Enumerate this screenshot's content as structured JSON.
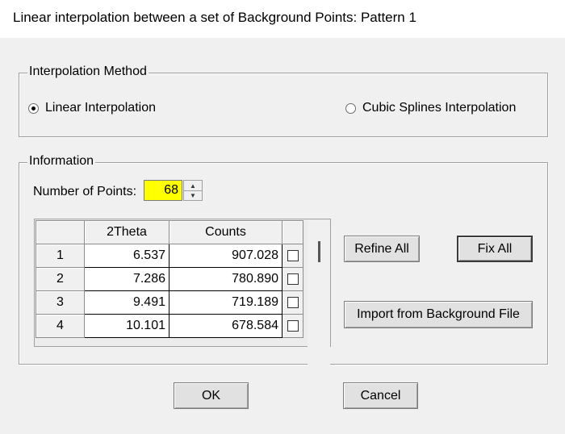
{
  "window": {
    "title": "Linear interpolation between a set of Background Points: Pattern 1"
  },
  "interpolation": {
    "group_label": "Interpolation Method",
    "linear_label": "Linear Interpolation",
    "cubic_label": "Cubic Splines Interpolation",
    "selected": "linear"
  },
  "information": {
    "group_label": "Information",
    "num_points_label": "Number of Points:",
    "num_points_value": "68",
    "num_points_bg": "#ffff00"
  },
  "grid": {
    "columns": [
      "2Theta",
      "Counts"
    ],
    "rows": [
      {
        "index": "1",
        "theta": "6.537",
        "counts": "907.028",
        "checked": false
      },
      {
        "index": "2",
        "theta": "7.286",
        "counts": "780.890",
        "checked": false
      },
      {
        "index": "3",
        "theta": "9.491",
        "counts": "719.189",
        "checked": false
      },
      {
        "index": "4",
        "theta": "10.101",
        "counts": "678.584",
        "checked": false
      }
    ]
  },
  "buttons": {
    "refine_all": "Refine All",
    "fix_all": "Fix All",
    "import_bg": "Import from Background File",
    "ok": "OK",
    "cancel": "Cancel"
  }
}
